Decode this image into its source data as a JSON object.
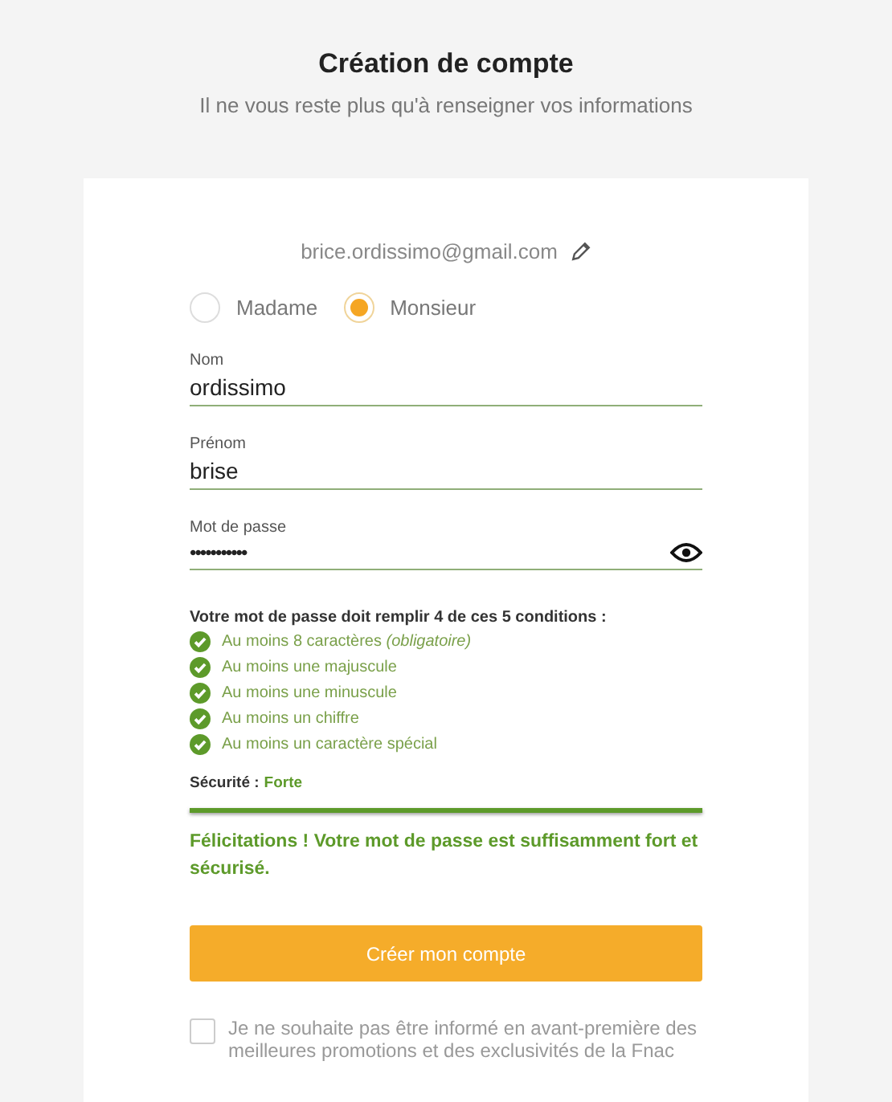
{
  "header": {
    "title": "Création de compte",
    "subtitle": "Il ne vous reste plus qu'à renseigner vos informations"
  },
  "email": "brice.ordissimo@gmail.com",
  "civility": [
    {
      "label": "Madame",
      "selected": false
    },
    {
      "label": "Monsieur",
      "selected": true
    }
  ],
  "fields": [
    {
      "label": "Nom",
      "value": "ordissimo",
      "kind": "text"
    },
    {
      "label": "Prénom",
      "value": "brise",
      "kind": "text"
    },
    {
      "label": "Mot de passe",
      "value": "•••••••••••",
      "kind": "password"
    }
  ],
  "rules": {
    "title": "Votre mot de passe doit remplir 4 de ces 5 conditions :",
    "items": [
      {
        "text": "Au moins 8 caractères *(obligatoire)*",
        "met": true
      },
      {
        "text": "Au moins une majuscule",
        "met": true
      },
      {
        "text": "Au moins une minuscule",
        "met": true
      },
      {
        "text": "Au moins un chiffre",
        "met": true
      },
      {
        "text": "Au moins un caractère spécial",
        "met": true
      }
    ]
  },
  "strength": {
    "label": "Sécurité :",
    "value": "Forte",
    "level": 1
  },
  "message": "Félicitations ! Votre mot de passe est suffisamment fort et sécurisé.",
  "submit": "Créer mon compte",
  "optout": {
    "text": "Je ne souhaite pas être informé en avant-première des meilleures promotions et des exclusivités de la Fnac",
    "checked": false
  }
}
